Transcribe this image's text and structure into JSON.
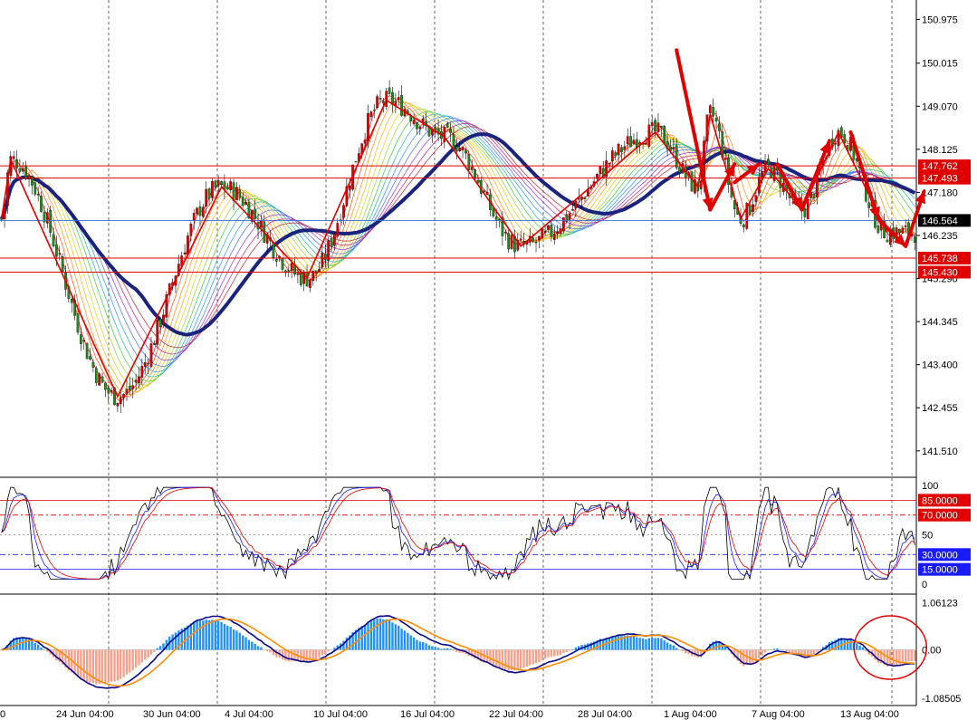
{
  "chart_data": {
    "type": "candlestick",
    "main": {
      "y_ticks": [
        "150.975",
        "150.015",
        "149.070",
        "148.125",
        "147.180",
        "146.235",
        "145.290",
        "144.345",
        "143.400",
        "142.455",
        "141.510"
      ],
      "ylim": [
        140.95,
        151.4
      ],
      "current_price": "146.564",
      "levels": [
        {
          "label": "147.762",
          "value": 147.762,
          "color": "#e00000"
        },
        {
          "label": "147.493",
          "value": 147.493,
          "color": "#e00000"
        },
        {
          "label": "145.738",
          "value": 145.738,
          "color": "#e00000"
        },
        {
          "label": "145.430",
          "value": 145.43,
          "color": "#e00000"
        }
      ],
      "current_line_color": "#3a6fd8",
      "ma_color": "#1a237e",
      "zigzag": [
        [
          0,
          146.6
        ],
        [
          3,
          147.9
        ],
        [
          38,
          142.7
        ],
        [
          72,
          147.3
        ],
        [
          100,
          145.3
        ],
        [
          126,
          149.2
        ],
        [
          145,
          148.4
        ],
        [
          170,
          146.0
        ],
        [
          214,
          148.5
        ],
        [
          228,
          147.3
        ],
        [
          232,
          148.9
        ],
        [
          242,
          146.6
        ],
        [
          251,
          147.7
        ],
        [
          262,
          146.8
        ],
        [
          274,
          148.5
        ],
        [
          290,
          146.3
        ]
      ],
      "arrows": [
        [
          [
            221,
            150.3
          ],
          [
            232,
            146.8
          ]
        ],
        [
          [
            232,
            146.8
          ],
          [
            240,
            147.8
          ]
        ],
        [
          [
            240,
            147.4
          ],
          [
            248,
            147.8
          ]
        ],
        [
          [
            254,
            147.8
          ],
          [
            262,
            146.8
          ]
        ],
        [
          [
            262,
            146.8
          ],
          [
            271,
            148.3
          ]
        ],
        [
          [
            278,
            148.5
          ],
          [
            287,
            146.6
          ]
        ],
        [
          [
            287,
            146.6
          ],
          [
            296,
            146.0
          ]
        ],
        [
          [
            296,
            146.0
          ],
          [
            302,
            147.2
          ]
        ]
      ]
    },
    "rsi": {
      "labels": [
        "85.0000",
        "70.0000",
        "30.0000",
        "15.0000"
      ],
      "values": [
        85,
        70,
        30,
        15
      ],
      "colors": [
        "#e00000",
        "#e00000",
        "#1a1aff",
        "#1a1aff"
      ],
      "ticks": [
        "100",
        "50",
        "0"
      ]
    },
    "macd": {
      "ticks": [
        "1.06123",
        "0.00",
        "-1.08505"
      ],
      "ylim": [
        -1.09,
        1.07
      ]
    },
    "x_labels": [
      "0",
      "24 Jun 04:00",
      "30 Jun 04:00",
      "4 Jul 04:00",
      "10 Jul 04:00",
      "16 Jul 04:00",
      "22 Jul 04:00",
      "28 Jul 04:00",
      "1 Aug 04:00",
      "7 Aug 04:00",
      "13 Aug 04:00"
    ],
    "x_label_positions": [
      0.2,
      19,
      37,
      55,
      74,
      92,
      110,
      129,
      147,
      165,
      184
    ],
    "candles": 300,
    "colors": {
      "up": "#e00000",
      "down": "#1a8f1a",
      "histogram_up": "#1e90ff",
      "histogram_down": "#f5a08a",
      "macd_line": "#0a0a8a",
      "signal_line": "#ff8c00",
      "circle": "#e00000"
    }
  }
}
